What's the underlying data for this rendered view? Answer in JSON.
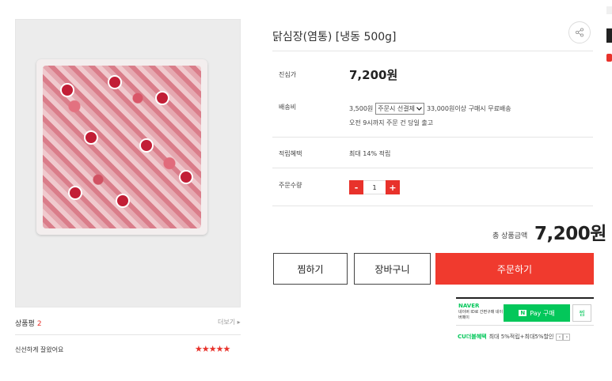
{
  "product": {
    "title": "닭심장(염통) [냉동 500g]"
  },
  "details": {
    "price_label": "진심가",
    "price": "7,200원",
    "shipping_label": "배송비",
    "shipping_fee": "3,500원",
    "shipping_option": "주문시 선결제",
    "shipping_condition": "33,000원이상 구매시 무료배송",
    "shipping_note": "오전 9시까지 주문 건 당일 출고",
    "points_label": "적립혜택",
    "points_value": "최대 14% 적립",
    "qty_label": "주문수량",
    "qty_value": "1",
    "minus": "-",
    "plus": "+"
  },
  "total": {
    "label": "총 상품금액",
    "value": "7,200원"
  },
  "buttons": {
    "wish": "찜하기",
    "cart": "장바구니",
    "order": "주문하기"
  },
  "naver": {
    "logo": "NAVER",
    "sub": "네이버 ID로 간편구매 네이버페이",
    "pay_n": "N",
    "pay_label": "Pay 구매",
    "wish": "찜",
    "promo_brand": "CU더블혜택",
    "promo_text": "최대 5%적립+최대5%할인",
    "prev": "‹",
    "next": "›"
  },
  "reviews": {
    "label": "상품평",
    "count": "2",
    "more": "더보기 ▸",
    "first_review": "신선하게 잘왔어요",
    "stars": "★★★★★",
    "rating": 5
  },
  "colors": {
    "accent": "#e8322b",
    "order_button": "#f03a2e",
    "naver_green": "#03c75a"
  },
  "icons": {
    "share": "share-icon",
    "dropdown": "chevron-down-icon"
  }
}
